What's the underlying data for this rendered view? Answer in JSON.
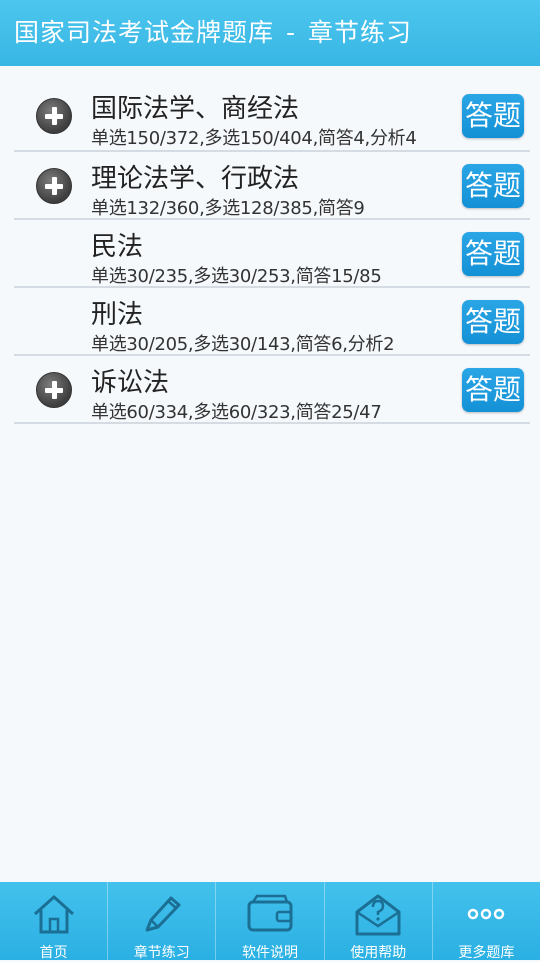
{
  "title": {
    "app": "国家司法考试金牌题库",
    "separator": "-",
    "section": "章节练习"
  },
  "chapters": [
    {
      "name": "国际法学、商经法",
      "stats": "单选150/372,多选150/404,简答4,分析4",
      "expandable": true,
      "answer_label": "答题"
    },
    {
      "name": "理论法学、行政法",
      "stats": "单选132/360,多选128/385,简答9",
      "expandable": true,
      "answer_label": "答题"
    },
    {
      "name": "民法",
      "stats": "单选30/235,多选30/253,简答15/85",
      "expandable": false,
      "answer_label": "答题"
    },
    {
      "name": "刑法",
      "stats": "单选30/205,多选30/143,简答6,分析2",
      "expandable": false,
      "answer_label": "答题"
    },
    {
      "name": "诉讼法",
      "stats": "单选60/334,多选60/323,简答25/47",
      "expandable": true,
      "answer_label": "答题"
    }
  ],
  "bottom_nav": [
    {
      "label": "首页",
      "icon": "home-icon"
    },
    {
      "label": "章节练习",
      "icon": "pencil-icon"
    },
    {
      "label": "软件说明",
      "icon": "wallet-icon"
    },
    {
      "label": "使用帮助",
      "icon": "help-envelope-icon"
    },
    {
      "label": "更多题库",
      "icon": "more-dots-icon"
    }
  ],
  "colors": {
    "header": "#38b6e4",
    "answer_button": "#1490d6",
    "background": "#f5f9fc"
  }
}
